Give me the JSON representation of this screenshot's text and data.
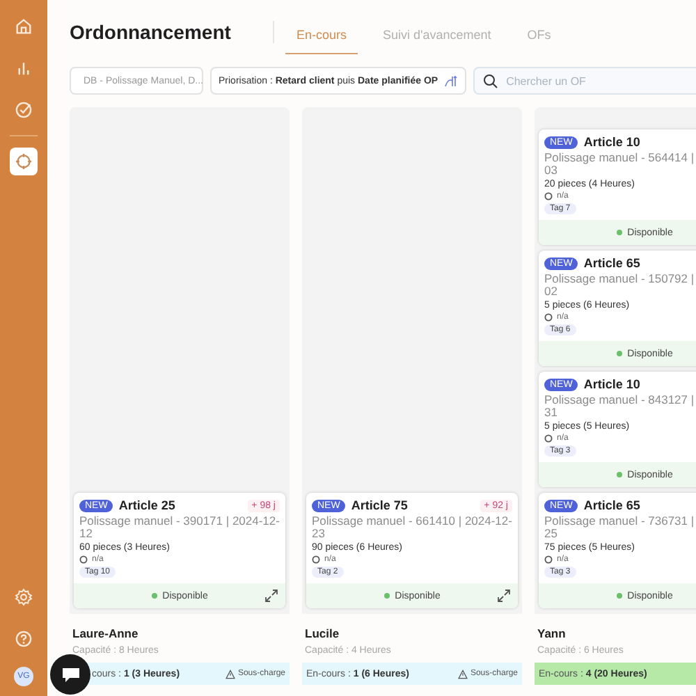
{
  "sidebar": {
    "items": [
      {
        "selected": false
      },
      {
        "selected": false
      },
      {
        "selected": false
      },
      {
        "selected": true
      }
    ],
    "avatar": "VG"
  },
  "title": "Ordonnancement",
  "tabs": [
    {
      "label": "En-cours",
      "selected": true
    },
    {
      "label": "Suivi d'avancement",
      "selected": false
    },
    {
      "label": "OFs",
      "selected": false
    }
  ],
  "filters": {
    "workstation": "DB - Polissage Manuel, D...",
    "priority": "Priorisation : **Retard client** puis **Date planifiée OP**",
    "search_placeholder": "Chercher un OF"
  },
  "columns": [
    {
      "name": "Laure-Anne",
      "capacity": "Capacité : 8 Heures",
      "underloaded": true,
      "summary": "cours : **1 (3 Heures)**",
      "warning": "Sous-charge",
      "cards": [
        {
          "badge": "NEW",
          "title": "Article 25",
          "late": "+ 98 j",
          "detail": [
            "Polissage manuel - 390171 | 2024-12-",
            "12"
          ],
          "quantity": "60 pieces (3 Heures)",
          "operator": "n/a",
          "tag": "Tag 10",
          "status": "Disponible",
          "expandable": true
        }
      ]
    },
    {
      "name": "Lucile",
      "capacity": "Capacité : 4 Heures",
      "underloaded": true,
      "summary": "En-cours : **1 (6 Heures)**",
      "warning": "Sous-charge",
      "cards": [
        {
          "badge": "NEW",
          "title": "Article 75",
          "late": "+ 92 j",
          "detail": [
            "Polissage manuel - 661410 | 2024-12-",
            "23"
          ],
          "quantity": "90 pieces (6 Heures)",
          "operator": "n/a",
          "tag": "Tag 2",
          "status": "Disponible",
          "expandable": true
        }
      ]
    },
    {
      "name": "Yann",
      "capacity": "Capacité : 6 Heures",
      "underloaded": false,
      "summary": "En-cours : **4 (20 Heures)**",
      "cards": [
        {
          "badge": "NEW",
          "title": "Article 10",
          "detail": [
            "Polissage manuel - 564414 |",
            "03"
          ],
          "quantity": "20 pieces (4 Heures)",
          "operator": "n/a",
          "tag": "Tag 7",
          "status": "Disponible"
        },
        {
          "badge": "NEW",
          "title": "Article 65",
          "detail": [
            "Polissage manuel - 150792 |",
            "02"
          ],
          "quantity": "5 pieces (6 Heures)",
          "operator": "n/a",
          "tag": "Tag 6",
          "status": "Disponible"
        },
        {
          "badge": "NEW",
          "title": "Article 10",
          "detail": [
            "Polissage manuel - 843127 |",
            "31"
          ],
          "quantity": "5 pieces (5 Heures)",
          "operator": "n/a",
          "tag": "Tag 3",
          "status": "Disponible"
        },
        {
          "badge": "NEW",
          "title": "Article 65",
          "detail": [
            "Polissage manuel - 736731 |",
            "25"
          ],
          "quantity": "75 pieces (5 Heures)",
          "operator": "n/a",
          "tag": "Tag 3",
          "status": "Disponible"
        }
      ]
    }
  ]
}
